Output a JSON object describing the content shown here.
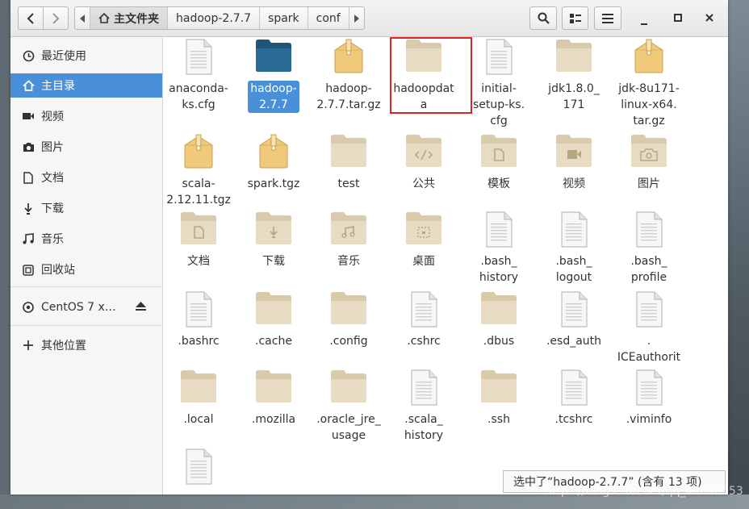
{
  "app": {
    "title": "文件管理器"
  },
  "header": {
    "breadcrumbs": [
      "主文件夹",
      "hadoop-2.7.7",
      "spark",
      "conf"
    ],
    "search_icon": "search-icon",
    "view_icon": "grid-view-icon",
    "menu_icon": "hamburger-menu-icon",
    "minimize_label": "–",
    "maximize_label": "□",
    "close_label": "×"
  },
  "sidebar": {
    "items": [
      {
        "label": "最近使用",
        "icon": "clock-icon"
      },
      {
        "label": "主目录",
        "icon": "home-icon"
      },
      {
        "label": "视频",
        "icon": "video-icon"
      },
      {
        "label": "图片",
        "icon": "camera-icon"
      },
      {
        "label": "文档",
        "icon": "document-icon"
      },
      {
        "label": "下载",
        "icon": "download-icon"
      },
      {
        "label": "音乐",
        "icon": "music-icon"
      },
      {
        "label": "回收站",
        "icon": "trash-icon"
      }
    ],
    "drive": {
      "label": "CentOS 7 x…",
      "icon": "disc-icon"
    },
    "other": {
      "label": "其他位置",
      "icon": "plus-icon"
    }
  },
  "files": [
    {
      "name": "anaconda-ks.cfg",
      "type": "doc"
    },
    {
      "name": "hadoop-2.7.7",
      "type": "folder-blue"
    },
    {
      "name": "hadoop-2.7.7.tar.gz",
      "type": "archive"
    },
    {
      "name": "hadoopdata",
      "type": "folder"
    },
    {
      "name": "initial-setup-ks.cfg",
      "type": "doc"
    },
    {
      "name": "jdk1.8.0_171",
      "type": "folder"
    },
    {
      "name": "jdk-8u171-linux-x64.tar.gz",
      "type": "archive"
    },
    {
      "name": "scala-2.12.11.tgz",
      "type": "archive"
    },
    {
      "name": "spark.tgz",
      "type": "archive"
    },
    {
      "name": "test",
      "type": "folder"
    },
    {
      "name": "公共",
      "type": "folder-share"
    },
    {
      "name": "模板",
      "type": "folder-template"
    },
    {
      "name": "视频",
      "type": "folder-video"
    },
    {
      "name": "图片",
      "type": "folder-camera"
    },
    {
      "name": "文档",
      "type": "folder-doc"
    },
    {
      "name": "下载",
      "type": "folder-download"
    },
    {
      "name": "音乐",
      "type": "folder-music"
    },
    {
      "name": "桌面",
      "type": "folder-desktop"
    },
    {
      "name": ".bash_history",
      "type": "doc"
    },
    {
      "name": ".bash_logout",
      "type": "doc"
    },
    {
      "name": ".bash_profile",
      "type": "doc"
    },
    {
      "name": ".bashrc",
      "type": "doc"
    },
    {
      "name": ".cache",
      "type": "folder"
    },
    {
      "name": ".config",
      "type": "folder"
    },
    {
      "name": ".cshrc",
      "type": "doc"
    },
    {
      "name": ".dbus",
      "type": "folder"
    },
    {
      "name": ".esd_auth",
      "type": "doc"
    },
    {
      "name": ".ICEauthority",
      "type": "doc"
    },
    {
      "name": ".local",
      "type": "folder"
    },
    {
      "name": ".mozilla",
      "type": "folder"
    },
    {
      "name": ".oracle_jre_usage",
      "type": "folder"
    },
    {
      "name": ".scala_history",
      "type": "doc"
    },
    {
      "name": ".ssh",
      "type": "folder"
    },
    {
      "name": ".tcshrc",
      "type": "doc"
    },
    {
      "name": ".viminfo",
      "type": "doc"
    },
    {
      "name": "",
      "type": "doc"
    }
  ],
  "file_labels": [
    [
      "anaconda-",
      "ks.cfg"
    ],
    [
      "hadoop-",
      "2.7.7"
    ],
    [
      "hadoop-",
      "2.7.7.tar.gz"
    ],
    [
      "hadoopdata"
    ],
    [
      "initial-",
      "setup-ks.",
      "cfg"
    ],
    [
      "jdk1.8.0_",
      "171"
    ],
    [
      "jdk-8u171-",
      "linux-x64.",
      "tar.gz"
    ],
    [
      "scala-",
      "2.12.11.tgz"
    ],
    [
      "spark.tgz"
    ],
    [
      "test"
    ],
    [
      "公共"
    ],
    [
      "模板"
    ],
    [
      "视频"
    ],
    [
      "图片"
    ],
    [
      "文档"
    ],
    [
      "下载"
    ],
    [
      "音乐"
    ],
    [
      "桌面"
    ],
    [
      ".bash_",
      "history"
    ],
    [
      ".bash_",
      "logout"
    ],
    [
      ".bash_",
      "profile"
    ],
    [
      ".bashrc"
    ],
    [
      ".cache"
    ],
    [
      ".config"
    ],
    [
      ".cshrc"
    ],
    [
      ".dbus"
    ],
    [
      ".esd_auth"
    ],
    [
      ".",
      "ICEauthority"
    ],
    [
      ".local"
    ],
    [
      ".mozilla"
    ],
    [
      ".oracle_jre_",
      "usage"
    ],
    [
      ".scala_",
      "history"
    ],
    [
      ".ssh"
    ],
    [
      ".tcshrc"
    ],
    [
      ".viminfo"
    ],
    []
  ],
  "selected_index": 1,
  "status": {
    "text": "选中了“hadoop-2.7.7” (含有 13 项)"
  },
  "watermark": "https://blog.csdn.net/qq_44646053",
  "colors": {
    "accent": "#4a90d9",
    "folder": "#e7dcc3",
    "folder_tab": "#d9cba9",
    "folder_blue": "#2a6a96",
    "highlight": "#e02424"
  }
}
